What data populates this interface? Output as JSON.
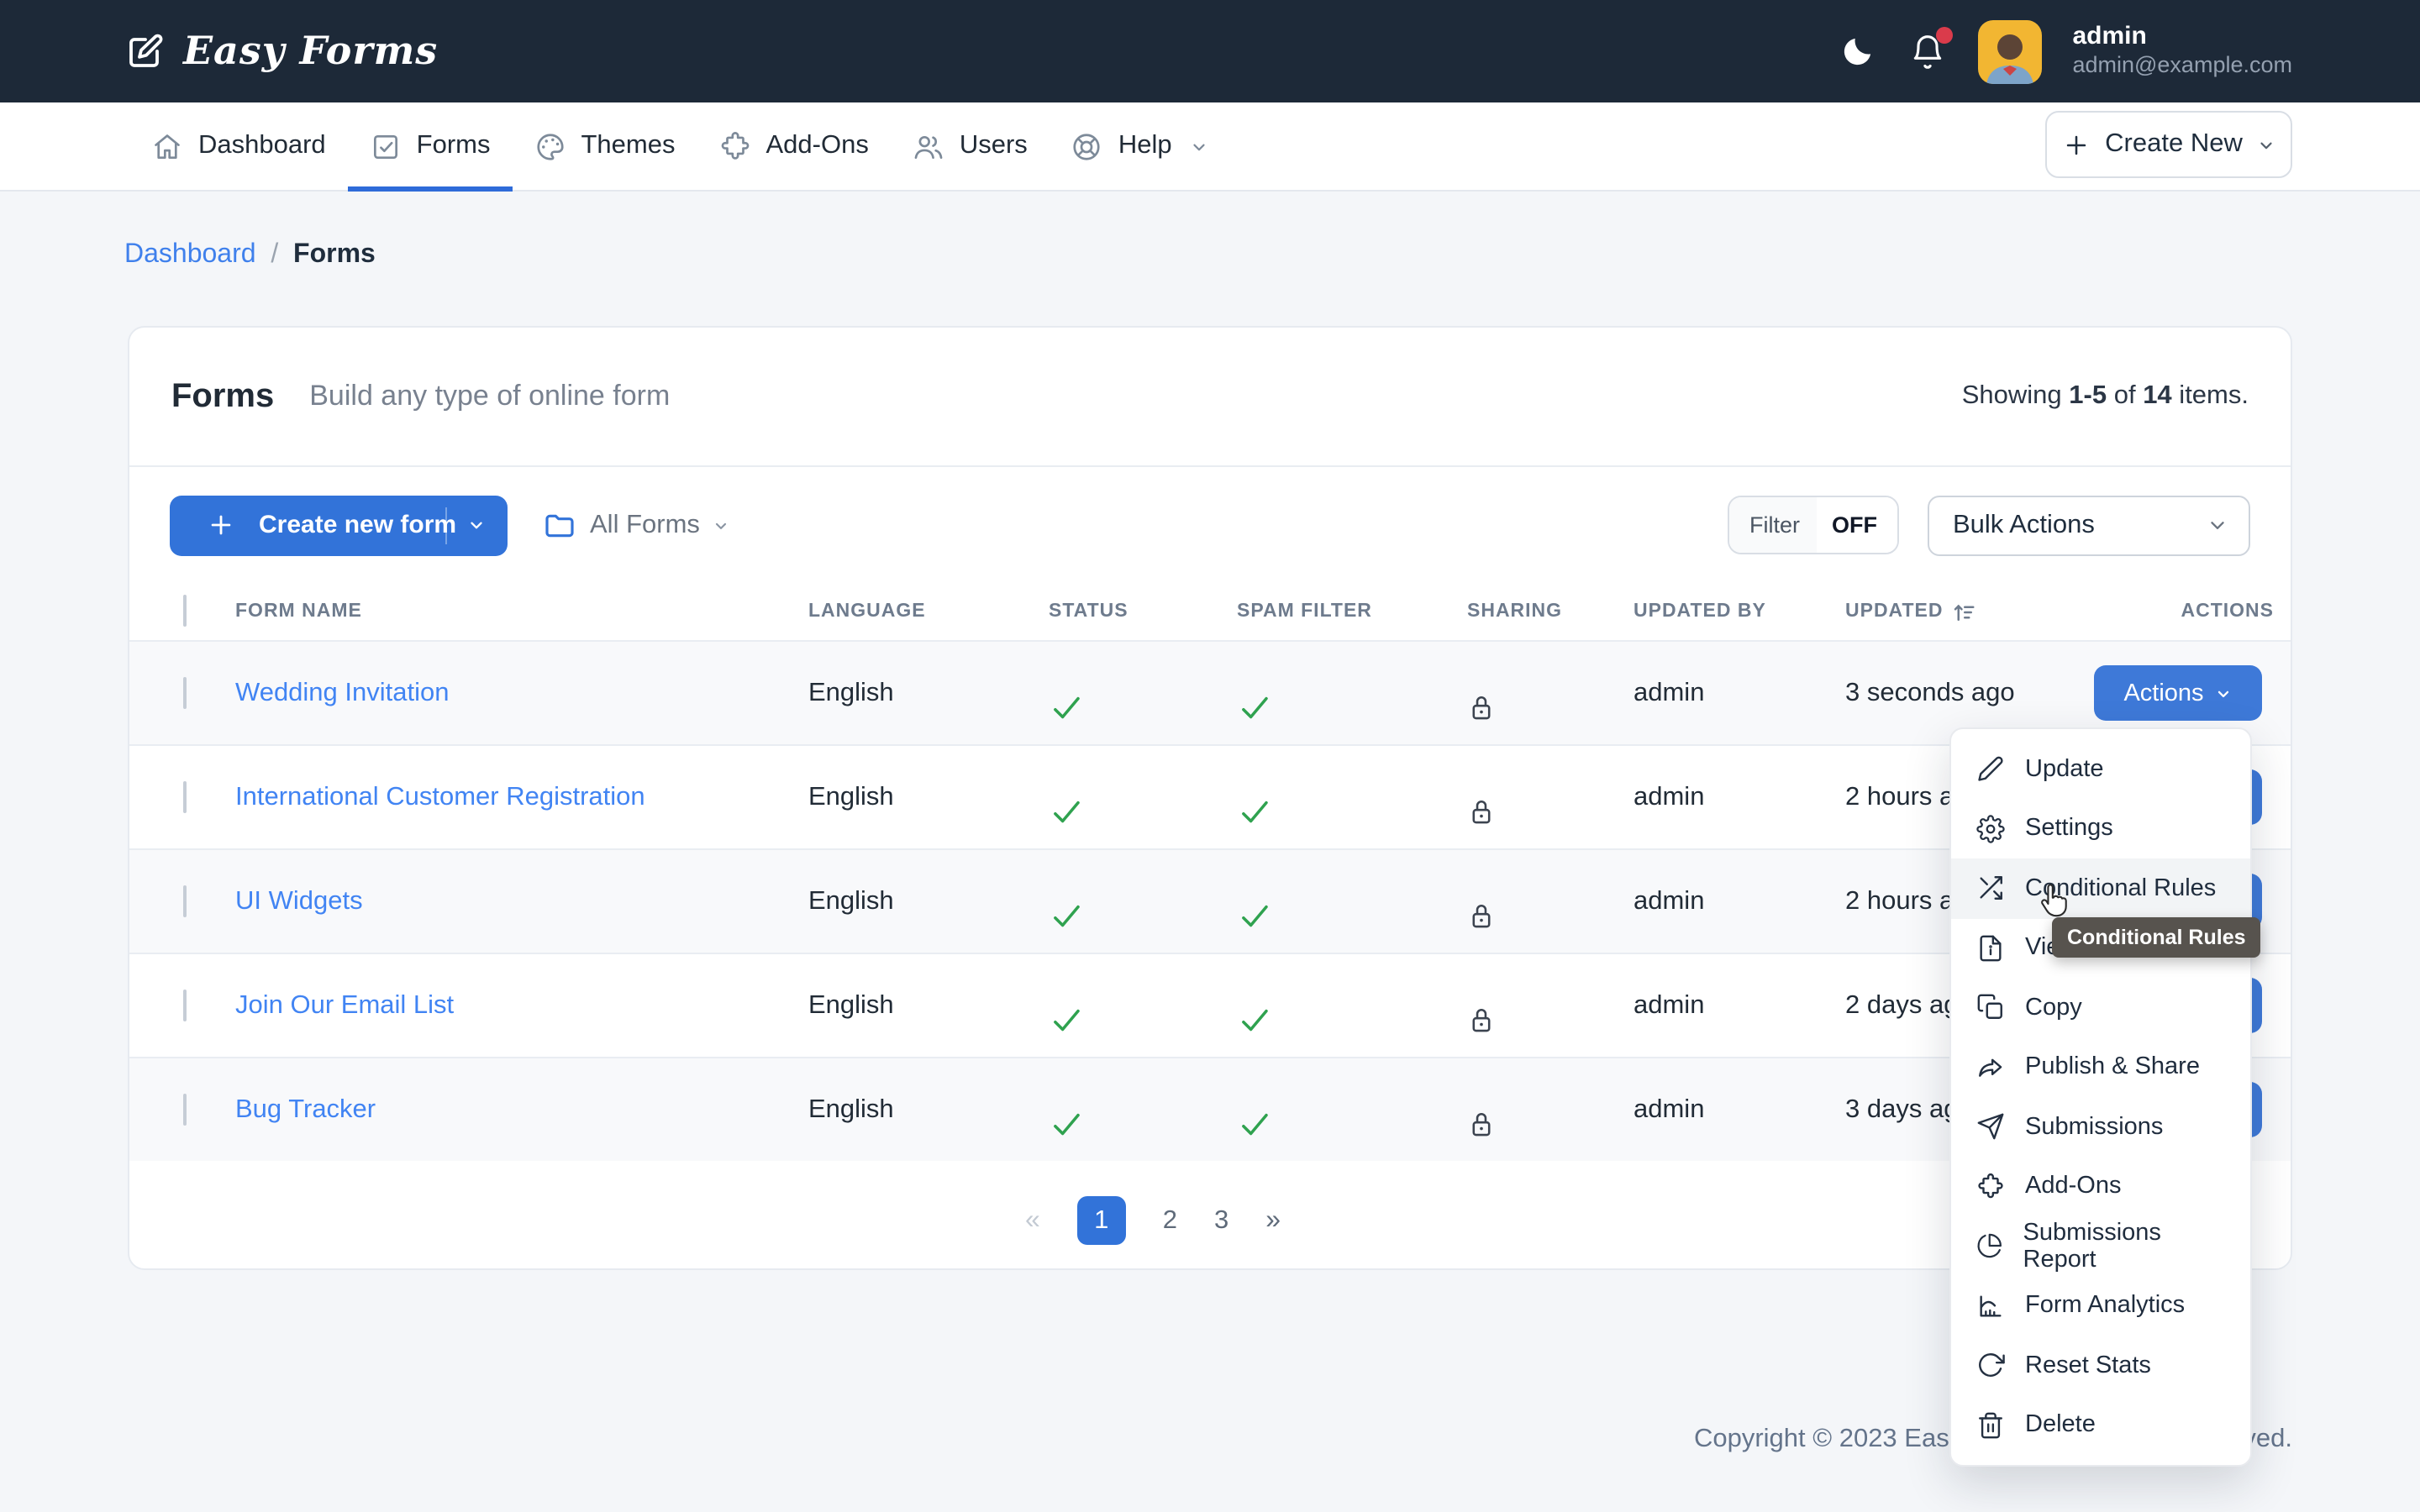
{
  "topbar": {
    "brand": "Easy Forms",
    "user_name": "admin",
    "user_email": "admin@example.com"
  },
  "nav": {
    "items": [
      {
        "label": "Dashboard",
        "icon": "house-icon",
        "active": false
      },
      {
        "label": "Forms",
        "icon": "check-square-icon",
        "active": true
      },
      {
        "label": "Themes",
        "icon": "palette-icon",
        "active": false
      },
      {
        "label": "Add-Ons",
        "icon": "puzzle-icon",
        "active": false
      },
      {
        "label": "Users",
        "icon": "users-icon",
        "active": false
      },
      {
        "label": "Help",
        "icon": "life-ring-icon",
        "active": false,
        "has_caret": true
      }
    ],
    "create_new": "Create New"
  },
  "breadcrumb": {
    "link": "Dashboard",
    "separator": "  /  ",
    "current": "Forms"
  },
  "page": {
    "title": "Forms",
    "subtitle": "Build any type of online form",
    "showing_prefix": "Showing ",
    "showing_range": "1-5",
    "showing_mid": " of ",
    "showing_total": "14",
    "showing_suffix": " items."
  },
  "toolbar": {
    "create_form": "Create new form",
    "folder": "All Forms",
    "filter_label": "Filter",
    "filter_value": "OFF",
    "bulk_actions": "Bulk Actions"
  },
  "table": {
    "columns": [
      "Form Name",
      "Language",
      "Status",
      "Spam Filter",
      "Sharing",
      "Updated By",
      "Updated",
      "Actions"
    ],
    "sorted_column": "Updated",
    "actions_label": "Actions",
    "rows": [
      {
        "name": "Wedding Invitation",
        "language": "English",
        "status": "checked",
        "spam_filter": "checked",
        "sharing": "lock",
        "updated_by": "admin",
        "updated": "3 seconds ago"
      },
      {
        "name": "International Customer Registration",
        "language": "English",
        "status": "checked",
        "spam_filter": "checked",
        "sharing": "lock",
        "updated_by": "admin",
        "updated": "2 hours ago"
      },
      {
        "name": "UI Widgets",
        "language": "English",
        "status": "checked",
        "spam_filter": "checked",
        "sharing": "lock",
        "updated_by": "admin",
        "updated": "2 hours ago"
      },
      {
        "name": "Join Our Email List",
        "language": "English",
        "status": "checked",
        "spam_filter": "checked",
        "sharing": "lock",
        "updated_by": "admin",
        "updated": "2 days ago"
      },
      {
        "name": "Bug Tracker",
        "language": "English",
        "status": "checked",
        "spam_filter": "checked",
        "sharing": "lock",
        "updated_by": "admin",
        "updated": "3 days ago"
      }
    ]
  },
  "pagination": {
    "first": "«",
    "pages": [
      "1",
      "2",
      "3"
    ],
    "active_page": "1",
    "last": "»"
  },
  "context_menu": {
    "items": [
      {
        "label": "Update",
        "icon": "pencil-icon"
      },
      {
        "label": "Settings",
        "icon": "gear-icon"
      },
      {
        "label": "Conditional Rules",
        "icon": "shuffle-icon",
        "hovered": true
      },
      {
        "label": "View",
        "icon": "file-info-icon"
      },
      {
        "label": "Copy",
        "icon": "copy-icon"
      },
      {
        "label": "Publish & Share",
        "icon": "share-icon"
      },
      {
        "label": "Submissions",
        "icon": "send-icon"
      },
      {
        "label": "Add-Ons",
        "icon": "puzzle-icon"
      },
      {
        "label": "Submissions Report",
        "icon": "pie-chart-icon"
      },
      {
        "label": "Form Analytics",
        "icon": "bar-chart-icon"
      },
      {
        "label": "Reset Stats",
        "icon": "refresh-icon"
      },
      {
        "label": "Delete",
        "icon": "trash-icon"
      }
    ]
  },
  "tooltip": "Conditional Rules",
  "footer": "Copyright © 2023 Easy Forms. All Rights Reserved.",
  "colors": {
    "navbar_bg": "#1d2938",
    "primary": "#3273d9",
    "link": "#4184f3",
    "success": "#2fa24f",
    "tooltip_bg": "#57534e",
    "page_bg": "#f4f6f9",
    "notification_dot": "#da3b4b"
  }
}
